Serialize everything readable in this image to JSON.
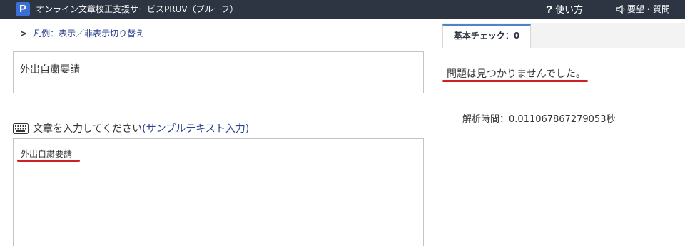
{
  "header": {
    "logo_letter": "P",
    "app_title": "オンライン文章校正支援サービスPRUV（プルーフ）",
    "help_label": "使い方",
    "request_label": "要望・質問"
  },
  "editor": {
    "legend_toggle": "凡例：表示／非表示切り替え",
    "title_value": "外出自粛要請",
    "input_prompt": "文章を入力してください",
    "sample_link": "(サンプルテキスト入力)",
    "body_text": "外出自粛要請"
  },
  "results": {
    "tab_basic_check": "基本チェック：0",
    "message": "問題は見つかりませんでした。",
    "analysis_time": "解析時間：0.011067867279053秒"
  },
  "colors": {
    "header_bg": "#2d3542",
    "link": "#2a3f8f",
    "error_underline": "#cc2222",
    "tab_accent": "#4a86c8"
  }
}
